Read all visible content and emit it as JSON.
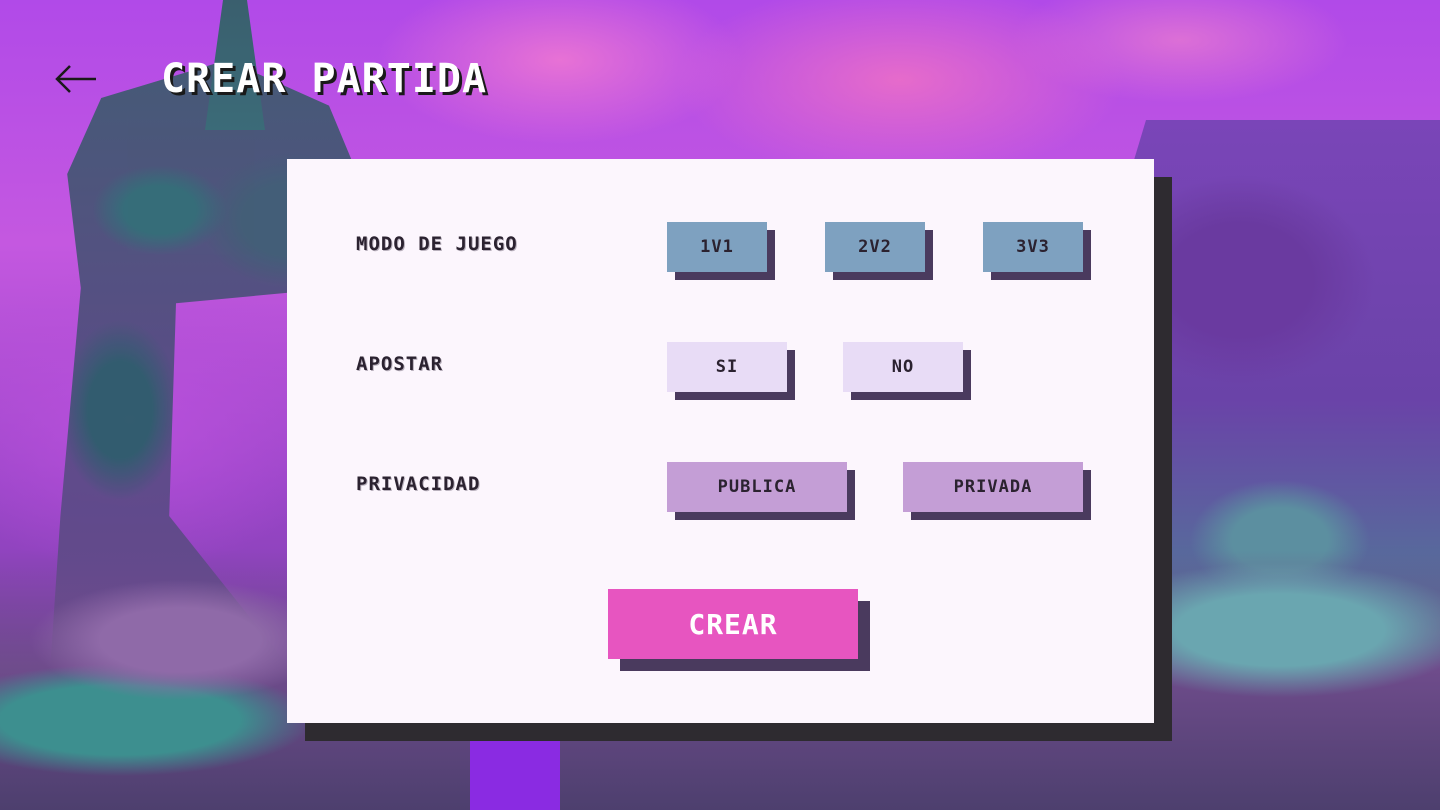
{
  "header": {
    "back_icon": "arrow-left-icon",
    "title": "CREAR PARTIDA"
  },
  "form": {
    "game_mode": {
      "label": "MODO DE JUEGO",
      "options": [
        "1V1",
        "2V2",
        "3V3"
      ]
    },
    "bet": {
      "label": "APOSTAR",
      "options": [
        "SI",
        "NO"
      ]
    },
    "privacy": {
      "label": "PRIVACIDAD",
      "options": [
        "PUBLICA",
        "PRIVADA"
      ]
    },
    "submit_label": "CREAR"
  },
  "colors": {
    "mode_button": "#7ea1c0",
    "bet_button": "#e8dcf6",
    "privacy_button": "#c49ed6",
    "create_button": "#e755c0",
    "panel": "#fcf6fd",
    "shadow": "#4a3a5e"
  }
}
